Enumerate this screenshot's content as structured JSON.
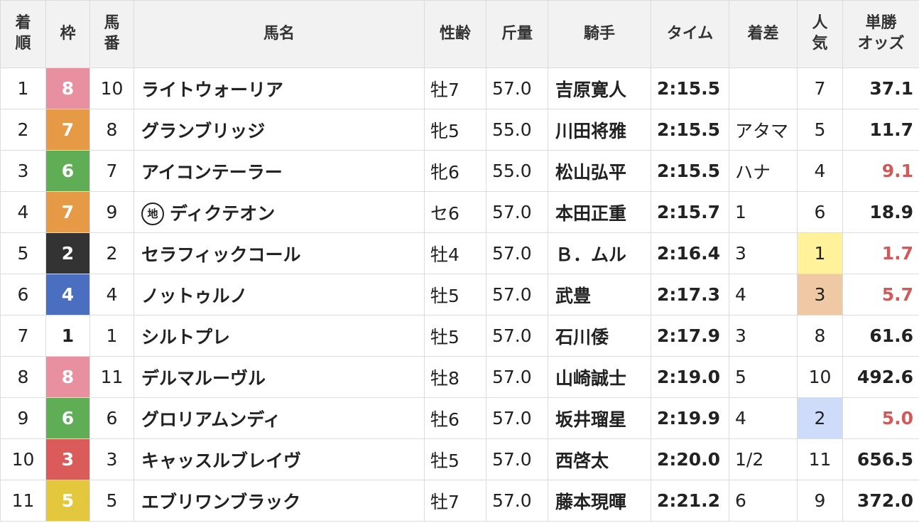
{
  "headers": {
    "rank": [
      "着",
      "順"
    ],
    "frame": "枠",
    "num": [
      "馬",
      "番"
    ],
    "name": "馬名",
    "sexage": "性齢",
    "weight": "斤量",
    "jockey": "騎手",
    "time": "タイム",
    "margin": "着差",
    "pop": [
      "人",
      "気"
    ],
    "odds": [
      "単勝",
      "オッズ"
    ]
  },
  "local_badge_text": "地",
  "frame_colors": {
    "1": {
      "bg": "#ffffff",
      "fg": "#222222"
    },
    "2": {
      "bg": "#333333",
      "fg": "#ffffff"
    },
    "3": {
      "bg": "#db5a5a",
      "fg": "#ffffff"
    },
    "4": {
      "bg": "#4a6fc0",
      "fg": "#ffffff"
    },
    "5": {
      "bg": "#e3c73c",
      "fg": "#ffffff"
    },
    "6": {
      "bg": "#5fae56",
      "fg": "#ffffff"
    },
    "7": {
      "bg": "#e79a46",
      "fg": "#ffffff"
    },
    "8": {
      "bg": "#e8909f",
      "fg": "#ffffff"
    }
  },
  "popularity_highlight": {
    "1": "#fff29a",
    "2": "#cfdcf9",
    "3": "#eec9a4"
  },
  "low_odds_color": "#d05a5a",
  "normal_odds_color": "#222222",
  "rows": [
    {
      "rank": "1",
      "frame": "8",
      "num": "10",
      "name": "ライトウォーリア",
      "local": false,
      "sexage": "牡7",
      "weight": "57.0",
      "jockey": "吉原寛人",
      "time": "2:15.5",
      "margin": "",
      "pop": "7",
      "odds": "37.1",
      "odds_low": false
    },
    {
      "rank": "2",
      "frame": "7",
      "num": "8",
      "name": "グランブリッジ",
      "local": false,
      "sexage": "牝5",
      "weight": "55.0",
      "jockey": "川田将雅",
      "time": "2:15.5",
      "margin": "アタマ",
      "pop": "5",
      "odds": "11.7",
      "odds_low": false
    },
    {
      "rank": "3",
      "frame": "6",
      "num": "7",
      "name": "アイコンテーラー",
      "local": false,
      "sexage": "牝6",
      "weight": "55.0",
      "jockey": "松山弘平",
      "time": "2:15.5",
      "margin": "ハナ",
      "pop": "4",
      "odds": "9.1",
      "odds_low": true
    },
    {
      "rank": "4",
      "frame": "7",
      "num": "9",
      "name": "ディクテオン",
      "local": true,
      "sexage": "セ6",
      "weight": "57.0",
      "jockey": "本田正重",
      "time": "2:15.7",
      "margin": "1",
      "pop": "6",
      "odds": "18.9",
      "odds_low": false
    },
    {
      "rank": "5",
      "frame": "2",
      "num": "2",
      "name": "セラフィックコール",
      "local": false,
      "sexage": "牡4",
      "weight": "57.0",
      "jockey": "Ｂ．ムル",
      "time": "2:16.4",
      "margin": "3",
      "pop": "1",
      "odds": "1.7",
      "odds_low": true
    },
    {
      "rank": "6",
      "frame": "4",
      "num": "4",
      "name": "ノットゥルノ",
      "local": false,
      "sexage": "牡5",
      "weight": "57.0",
      "jockey": "武豊",
      "time": "2:17.3",
      "margin": "4",
      "pop": "3",
      "odds": "5.7",
      "odds_low": true
    },
    {
      "rank": "7",
      "frame": "1",
      "num": "1",
      "name": "シルトプレ",
      "local": false,
      "sexage": "牡5",
      "weight": "57.0",
      "jockey": "石川倭",
      "time": "2:17.9",
      "margin": "3",
      "pop": "8",
      "odds": "61.6",
      "odds_low": false
    },
    {
      "rank": "8",
      "frame": "8",
      "num": "11",
      "name": "デルマルーヴル",
      "local": false,
      "sexage": "牡8",
      "weight": "57.0",
      "jockey": "山崎誠士",
      "time": "2:19.0",
      "margin": "5",
      "pop": "10",
      "odds": "492.6",
      "odds_low": false
    },
    {
      "rank": "9",
      "frame": "6",
      "num": "6",
      "name": "グロリアムンディ",
      "local": false,
      "sexage": "牡6",
      "weight": "57.0",
      "jockey": "坂井瑠星",
      "time": "2:19.9",
      "margin": "4",
      "pop": "2",
      "odds": "5.0",
      "odds_low": true
    },
    {
      "rank": "10",
      "frame": "3",
      "num": "3",
      "name": "キャッスルブレイヴ",
      "local": false,
      "sexage": "牡5",
      "weight": "57.0",
      "jockey": "西啓太",
      "time": "2:20.0",
      "margin": "1/2",
      "pop": "11",
      "odds": "656.5",
      "odds_low": false
    },
    {
      "rank": "11",
      "frame": "5",
      "num": "5",
      "name": "エブリワンブラック",
      "local": false,
      "sexage": "牡7",
      "weight": "57.0",
      "jockey": "藤本現暉",
      "time": "2:21.2",
      "margin": "6",
      "pop": "9",
      "odds": "372.0",
      "odds_low": false
    }
  ]
}
